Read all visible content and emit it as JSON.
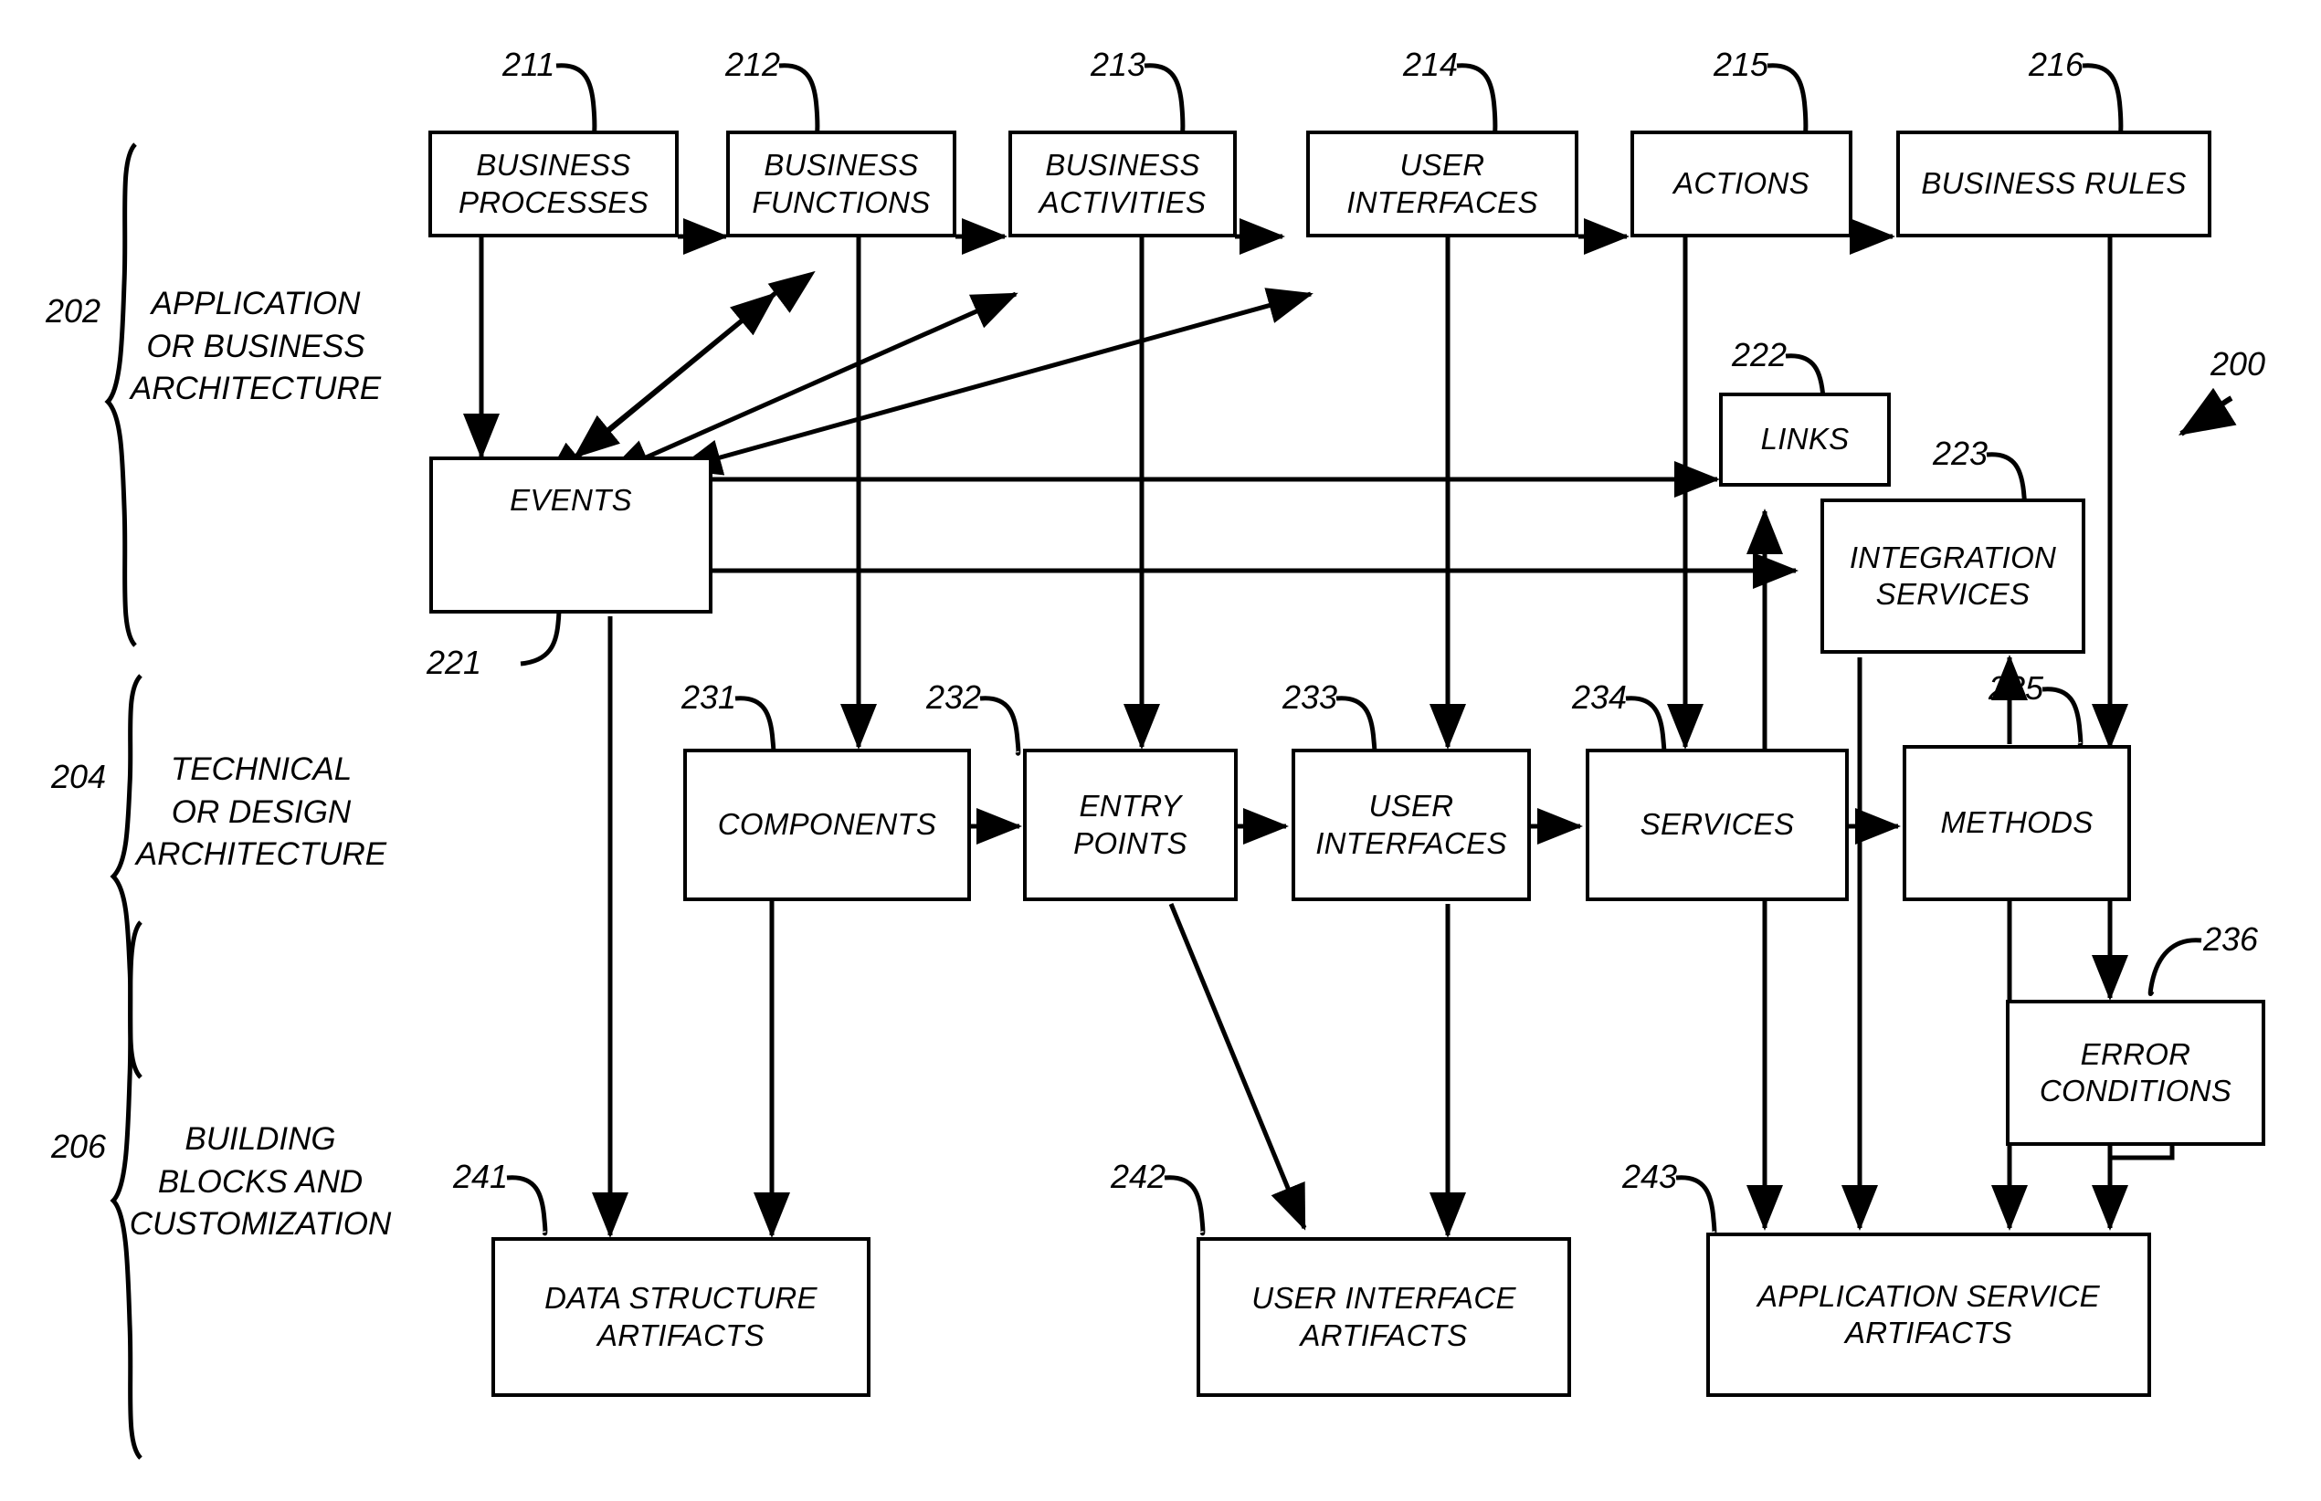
{
  "figure": {
    "figure_ref": "200"
  },
  "sections": [
    {
      "ref": "202",
      "label": "APPLICATION\nOR BUSINESS\nARCHITECTURE"
    },
    {
      "ref": "204",
      "label": "TECHNICAL\nOR DESIGN\nARCHITECTURE"
    },
    {
      "ref": "206",
      "label": "BUILDING\nBLOCKS AND\nCUSTOMIZATION"
    }
  ],
  "nodes": [
    {
      "id": "business-processes",
      "ref": "211",
      "label": "BUSINESS\nPROCESSES"
    },
    {
      "id": "business-functions",
      "ref": "212",
      "label": "BUSINESS\nFUNCTIONS"
    },
    {
      "id": "business-activities",
      "ref": "213",
      "label": "BUSINESS\nACTIVITIES"
    },
    {
      "id": "user-interfaces-app",
      "ref": "214",
      "label": "USER\nINTERFACES"
    },
    {
      "id": "actions",
      "ref": "215",
      "label": "ACTIONS"
    },
    {
      "id": "business-rules",
      "ref": "216",
      "label": "BUSINESS RULES"
    },
    {
      "id": "events",
      "ref": "221",
      "label": "EVENTS"
    },
    {
      "id": "links",
      "ref": "222",
      "label": "LINKS"
    },
    {
      "id": "integration-services",
      "ref": "223",
      "label": "INTEGRATION\nSERVICES"
    },
    {
      "id": "components",
      "ref": "231",
      "label": "COMPONENTS"
    },
    {
      "id": "entry-points",
      "ref": "232",
      "label": "ENTRY\nPOINTS"
    },
    {
      "id": "user-interfaces-tech",
      "ref": "233",
      "label": "USER\nINTERFACES"
    },
    {
      "id": "services",
      "ref": "234",
      "label": "SERVICES"
    },
    {
      "id": "methods",
      "ref": "235",
      "label": "METHODS"
    },
    {
      "id": "error-conditions",
      "ref": "236",
      "label": "ERROR\nCONDITIONS"
    },
    {
      "id": "data-structure-artifacts",
      "ref": "241",
      "label": "DATA STRUCTURE\nARTIFACTS"
    },
    {
      "id": "user-interface-artifacts",
      "ref": "242",
      "label": "USER INTERFACE\nARTIFACTS"
    },
    {
      "id": "application-service-artifacts",
      "ref": "243",
      "label": "APPLICATION SERVICE\nARTIFACTS"
    }
  ],
  "colors": {
    "stroke": "#000000",
    "background": "#ffffff"
  }
}
